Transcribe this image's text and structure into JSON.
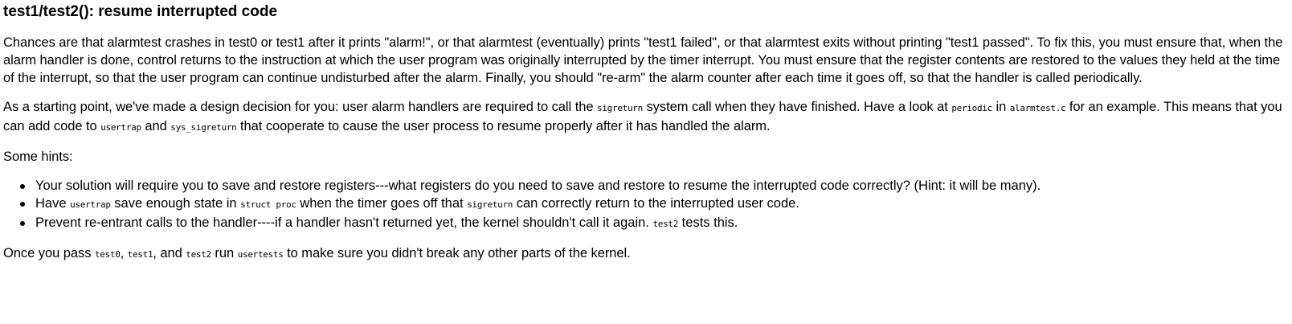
{
  "heading": "test1/test2(): resume interrupted code",
  "p1": "Chances are that alarmtest crashes in test0 or test1 after it prints \"alarm!\", or that alarmtest (eventually) prints \"test1 failed\", or that alarmtest exits without printing \"test1 passed\". To fix this, you must ensure that, when the alarm handler is done, control returns to the instruction at which the user program was originally interrupted by the timer interrupt. You must ensure that the register contents are restored to the values they held at the time of the interrupt, so that the user program can continue undisturbed after the alarm. Finally, you should \"re-arm\" the alarm counter after each time it goes off, so that the handler is called periodically.",
  "p2": {
    "t1": "As a starting point, we've made a design decision for you: user alarm handlers are required to call the ",
    "c1": "sigreturn",
    "t2": " system call when they have finished. Have a look at ",
    "c2": "periodic",
    "t3": " in ",
    "c3": "alarmtest.c",
    "t4": " for an example. This means that you can add code to ",
    "c4": "usertrap",
    "t5": " and ",
    "c5": "sys_sigreturn",
    "t6": " that cooperate to cause the user process to resume properly after it has handled the alarm."
  },
  "p3": "Some hints:",
  "hints": {
    "h1": "Your solution will require you to save and restore registers---what registers do you need to save and restore to resume the interrupted code correctly? (Hint: it will be many).",
    "h2": {
      "t1": "Have ",
      "c1": "usertrap",
      "t2": " save enough state in ",
      "c2": "struct proc",
      "t3": " when the timer goes off that ",
      "c3": "sigreturn",
      "t4": " can correctly return to the interrupted user code."
    },
    "h3": {
      "t1": "Prevent re-entrant calls to the handler----if a handler hasn't returned yet, the kernel shouldn't call it again. ",
      "c1": "test2",
      "t2": " tests this."
    }
  },
  "p4": {
    "t1": "Once you pass ",
    "c1": "test0",
    "t2": ", ",
    "c2": "test1",
    "t3": ", and ",
    "c3": "test2",
    "t4": " run ",
    "c4": "usertests",
    "t5": " to make sure you didn't break any other parts of the kernel."
  }
}
